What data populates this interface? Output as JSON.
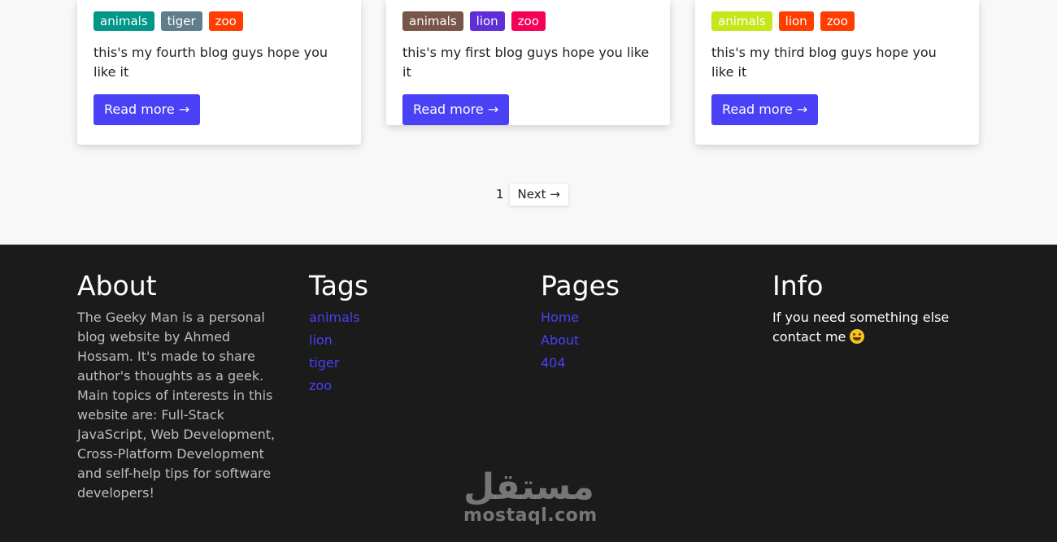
{
  "posts": [
    {
      "tags": [
        {
          "label": "animals",
          "color": "#009688"
        },
        {
          "label": "tiger",
          "color": "#607d8b"
        },
        {
          "label": "zoo",
          "color": "#ff3d00"
        }
      ],
      "excerpt": "this's my fourth blog guys hope you like it",
      "read_more": "Read more →"
    },
    {
      "tags": [
        {
          "label": "animals",
          "color": "#795548"
        },
        {
          "label": "lion",
          "color": "#5e2ed6"
        },
        {
          "label": "zoo",
          "color": "#f50057"
        }
      ],
      "excerpt": "this's my first blog guys hope you like it",
      "read_more": "Read more →"
    },
    {
      "tags": [
        {
          "label": "animals",
          "color": "#c6e619"
        },
        {
          "label": "lion",
          "color": "#ff3d00"
        },
        {
          "label": "zoo",
          "color": "#ff3d00"
        }
      ],
      "excerpt": "this's my third blog guys hope you like it",
      "read_more": "Read more →"
    }
  ],
  "pagination": {
    "current": "1",
    "next_label": "Next →"
  },
  "footer": {
    "about": {
      "title": "About",
      "text": "The Geeky Man is a personal blog website by Ahmed Hossam. It's made to share author's thoughts as a geek. Main topics of interests in this website are: Full-Stack JavaScript, Web Development, Cross-Platform Development and self-help tips for software developers!"
    },
    "tags": {
      "title": "Tags",
      "items": [
        "animals",
        "lion",
        "tiger",
        "zoo"
      ]
    },
    "pages": {
      "title": "Pages",
      "items": [
        "Home",
        "About",
        "404"
      ]
    },
    "info": {
      "title": "Info",
      "text": "If you need something else contact me",
      "emoji_icon": "grinning-face-icon"
    }
  },
  "watermark": {
    "arabic": "مستقل",
    "latin": "mostaql.com"
  },
  "colors": {
    "accent": "#4a40f5",
    "footer_bg": "#1b1b1b",
    "page_bg": "#f8f8f8"
  }
}
